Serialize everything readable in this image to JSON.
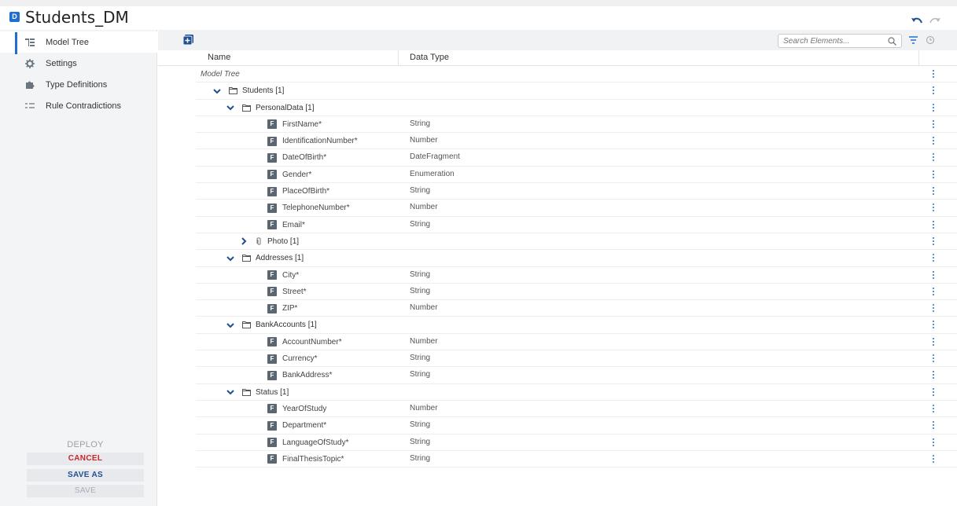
{
  "app": {
    "badge": "D",
    "title": "Students_DM"
  },
  "sidebar": {
    "items": [
      {
        "label": "Model Tree"
      },
      {
        "label": "Settings"
      },
      {
        "label": "Type Definitions"
      },
      {
        "label": "Rule Contradictions"
      }
    ],
    "buttons": {
      "deploy": "DEPLOY",
      "cancel": "CANCEL",
      "save_as": "SAVE AS",
      "save": "SAVE"
    }
  },
  "toolbar": {
    "search_placeholder": "Search Elements..."
  },
  "columns": {
    "name": "Name",
    "type": "Data Type"
  },
  "tree": {
    "root": "Model Tree",
    "students": "Students [1]",
    "personal_data": {
      "label": "PersonalData [1]",
      "fields": [
        {
          "name": "FirstName*",
          "type": "String"
        },
        {
          "name": "IdentificationNumber*",
          "type": "Number"
        },
        {
          "name": "DateOfBirth*",
          "type": "DateFragment"
        },
        {
          "name": "Gender*",
          "type": "Enumeration"
        },
        {
          "name": "PlaceOfBirth*",
          "type": "String"
        },
        {
          "name": "TelephoneNumber*",
          "type": "Number"
        },
        {
          "name": "Email*",
          "type": "String"
        }
      ],
      "photo": "Photo [1]"
    },
    "addresses": {
      "label": "Addresses [1]",
      "fields": [
        {
          "name": "City*",
          "type": "String"
        },
        {
          "name": "Street*",
          "type": "String"
        },
        {
          "name": "ZIP*",
          "type": "Number"
        }
      ]
    },
    "bank_accounts": {
      "label": "BankAccounts [1]",
      "fields": [
        {
          "name": "AccountNumber*",
          "type": "Number"
        },
        {
          "name": "Currency*",
          "type": "String"
        },
        {
          "name": "BankAddress*",
          "type": "String"
        }
      ]
    },
    "status": {
      "label": "Status [1]",
      "fields": [
        {
          "name": "YearOfStudy",
          "type": "Number"
        },
        {
          "name": "Department*",
          "type": "String"
        },
        {
          "name": "LanguageOfStudy*",
          "type": "String"
        },
        {
          "name": "FinalThesisTopic*",
          "type": "String"
        }
      ]
    },
    "field_badge": "F"
  },
  "colors": {
    "accent": "#1f6fd1",
    "cancel": "#c62828",
    "save_as": "#1f4f91",
    "field_badge": "#5c6670"
  }
}
